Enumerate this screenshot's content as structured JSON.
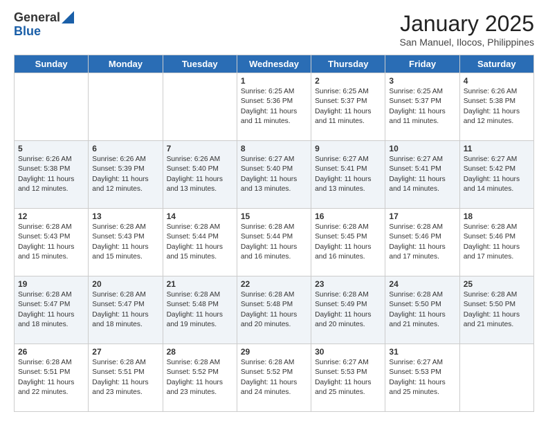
{
  "logo": {
    "general": "General",
    "blue": "Blue"
  },
  "header": {
    "month": "January 2025",
    "location": "San Manuel, Ilocos, Philippines"
  },
  "weekdays": [
    "Sunday",
    "Monday",
    "Tuesday",
    "Wednesday",
    "Thursday",
    "Friday",
    "Saturday"
  ],
  "weeks": [
    [
      {
        "day": null,
        "info": null
      },
      {
        "day": null,
        "info": null
      },
      {
        "day": null,
        "info": null
      },
      {
        "day": "1",
        "sunrise": "6:25 AM",
        "sunset": "5:36 PM",
        "daylight": "11 hours and 11 minutes."
      },
      {
        "day": "2",
        "sunrise": "6:25 AM",
        "sunset": "5:37 PM",
        "daylight": "11 hours and 11 minutes."
      },
      {
        "day": "3",
        "sunrise": "6:25 AM",
        "sunset": "5:37 PM",
        "daylight": "11 hours and 11 minutes."
      },
      {
        "day": "4",
        "sunrise": "6:26 AM",
        "sunset": "5:38 PM",
        "daylight": "11 hours and 12 minutes."
      }
    ],
    [
      {
        "day": "5",
        "sunrise": "6:26 AM",
        "sunset": "5:38 PM",
        "daylight": "11 hours and 12 minutes."
      },
      {
        "day": "6",
        "sunrise": "6:26 AM",
        "sunset": "5:39 PM",
        "daylight": "11 hours and 12 minutes."
      },
      {
        "day": "7",
        "sunrise": "6:26 AM",
        "sunset": "5:40 PM",
        "daylight": "11 hours and 13 minutes."
      },
      {
        "day": "8",
        "sunrise": "6:27 AM",
        "sunset": "5:40 PM",
        "daylight": "11 hours and 13 minutes."
      },
      {
        "day": "9",
        "sunrise": "6:27 AM",
        "sunset": "5:41 PM",
        "daylight": "11 hours and 13 minutes."
      },
      {
        "day": "10",
        "sunrise": "6:27 AM",
        "sunset": "5:41 PM",
        "daylight": "11 hours and 14 minutes."
      },
      {
        "day": "11",
        "sunrise": "6:27 AM",
        "sunset": "5:42 PM",
        "daylight": "11 hours and 14 minutes."
      }
    ],
    [
      {
        "day": "12",
        "sunrise": "6:28 AM",
        "sunset": "5:43 PM",
        "daylight": "11 hours and 15 minutes."
      },
      {
        "day": "13",
        "sunrise": "6:28 AM",
        "sunset": "5:43 PM",
        "daylight": "11 hours and 15 minutes."
      },
      {
        "day": "14",
        "sunrise": "6:28 AM",
        "sunset": "5:44 PM",
        "daylight": "11 hours and 15 minutes."
      },
      {
        "day": "15",
        "sunrise": "6:28 AM",
        "sunset": "5:44 PM",
        "daylight": "11 hours and 16 minutes."
      },
      {
        "day": "16",
        "sunrise": "6:28 AM",
        "sunset": "5:45 PM",
        "daylight": "11 hours and 16 minutes."
      },
      {
        "day": "17",
        "sunrise": "6:28 AM",
        "sunset": "5:46 PM",
        "daylight": "11 hours and 17 minutes."
      },
      {
        "day": "18",
        "sunrise": "6:28 AM",
        "sunset": "5:46 PM",
        "daylight": "11 hours and 17 minutes."
      }
    ],
    [
      {
        "day": "19",
        "sunrise": "6:28 AM",
        "sunset": "5:47 PM",
        "daylight": "11 hours and 18 minutes."
      },
      {
        "day": "20",
        "sunrise": "6:28 AM",
        "sunset": "5:47 PM",
        "daylight": "11 hours and 18 minutes."
      },
      {
        "day": "21",
        "sunrise": "6:28 AM",
        "sunset": "5:48 PM",
        "daylight": "11 hours and 19 minutes."
      },
      {
        "day": "22",
        "sunrise": "6:28 AM",
        "sunset": "5:48 PM",
        "daylight": "11 hours and 20 minutes."
      },
      {
        "day": "23",
        "sunrise": "6:28 AM",
        "sunset": "5:49 PM",
        "daylight": "11 hours and 20 minutes."
      },
      {
        "day": "24",
        "sunrise": "6:28 AM",
        "sunset": "5:50 PM",
        "daylight": "11 hours and 21 minutes."
      },
      {
        "day": "25",
        "sunrise": "6:28 AM",
        "sunset": "5:50 PM",
        "daylight": "11 hours and 21 minutes."
      }
    ],
    [
      {
        "day": "26",
        "sunrise": "6:28 AM",
        "sunset": "5:51 PM",
        "daylight": "11 hours and 22 minutes."
      },
      {
        "day": "27",
        "sunrise": "6:28 AM",
        "sunset": "5:51 PM",
        "daylight": "11 hours and 23 minutes."
      },
      {
        "day": "28",
        "sunrise": "6:28 AM",
        "sunset": "5:52 PM",
        "daylight": "11 hours and 23 minutes."
      },
      {
        "day": "29",
        "sunrise": "6:28 AM",
        "sunset": "5:52 PM",
        "daylight": "11 hours and 24 minutes."
      },
      {
        "day": "30",
        "sunrise": "6:27 AM",
        "sunset": "5:53 PM",
        "daylight": "11 hours and 25 minutes."
      },
      {
        "day": "31",
        "sunrise": "6:27 AM",
        "sunset": "5:53 PM",
        "daylight": "11 hours and 25 minutes."
      },
      {
        "day": null,
        "info": null
      }
    ]
  ],
  "labels": {
    "sunrise": "Sunrise:",
    "sunset": "Sunset:",
    "daylight": "Daylight:"
  }
}
